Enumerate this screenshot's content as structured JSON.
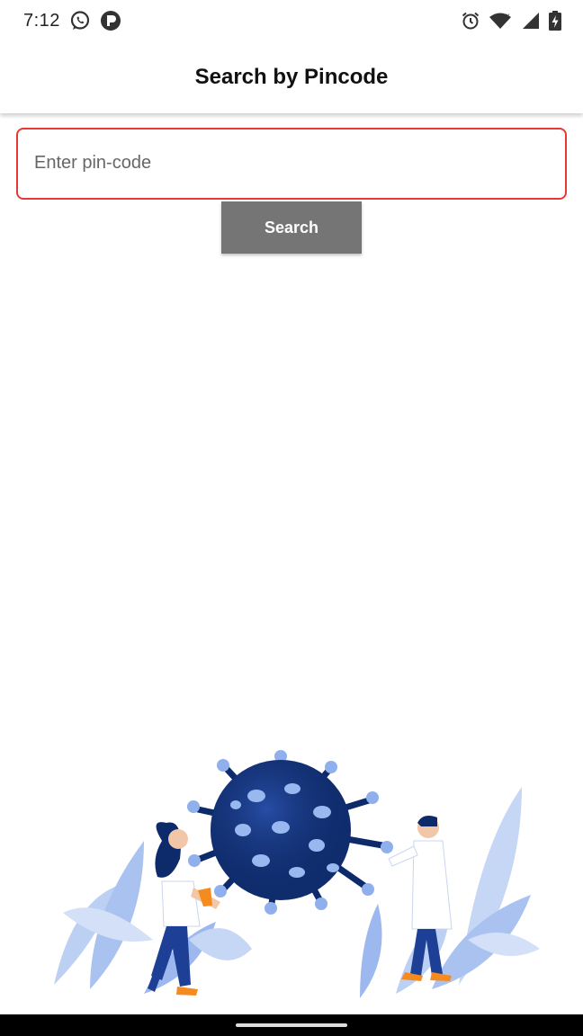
{
  "status_bar": {
    "time": "7:12",
    "left_icons": [
      "whatsapp-icon",
      "notification-app-icon"
    ],
    "right_icons": [
      "alarm-icon",
      "wifi-icon",
      "signal-icon",
      "battery-charging-icon"
    ]
  },
  "app_bar": {
    "title": "Search by Pincode"
  },
  "search": {
    "placeholder": "Enter pin-code",
    "value": "",
    "button_label": "Search",
    "border_color": "#e53935",
    "button_color": "#757575"
  },
  "illustration": {
    "icon": "virus-with-doctors-illustration"
  }
}
